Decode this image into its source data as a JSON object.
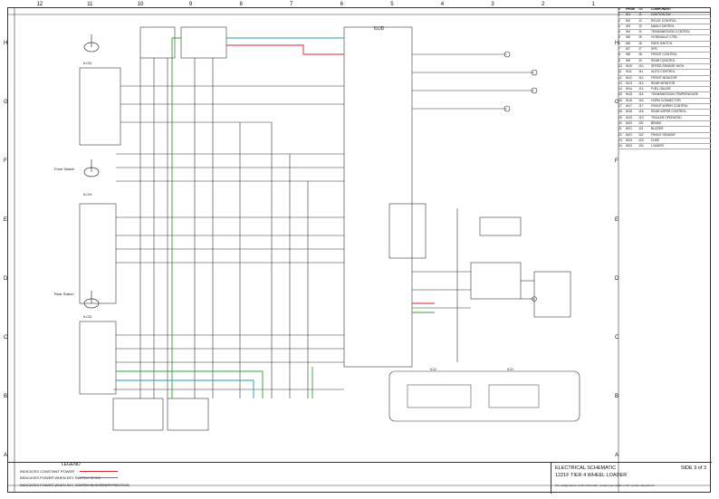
{
  "grid": {
    "columns_top": [
      "12",
      "11",
      "10",
      "9",
      "8",
      "7",
      "6",
      "5",
      "4",
      "3",
      "2",
      "1"
    ],
    "rows_left": [
      "H",
      "G",
      "F",
      "E",
      "D",
      "C",
      "B",
      "A"
    ],
    "rows_right": [
      "H",
      "G",
      "F",
      "E",
      "D",
      "C",
      "B",
      "A"
    ]
  },
  "components": {
    "top_ecu_label": "ILUD",
    "connector_left": "ILCN",
    "connector_mid": "ILCN",
    "switch_g_label": "ILCN",
    "ecu_bottom_left": "ICU",
    "ecu_bottom_right": "ICU",
    "front_switch": "Front Switch",
    "rear_switch": "Rear Switch"
  },
  "right_table": {
    "headers": [
      "#",
      "FROM",
      "TO",
      "COMPONENT"
    ],
    "rows": [
      [
        "1",
        "W1",
        "J1",
        "IGNITION SW"
      ],
      [
        "2",
        "W2",
        "J2",
        "RELAY CONTROL"
      ],
      [
        "3",
        "W3",
        "J3",
        "MAIN CONTROL"
      ],
      [
        "4",
        "W4",
        "J4",
        "TRANSMISSION CONTROL"
      ],
      [
        "5",
        "W5",
        "J5",
        "HYDRAULIC CTRL"
      ],
      [
        "6",
        "W6",
        "J6",
        "PARK SWITCH"
      ],
      [
        "7",
        "W7",
        "J7",
        "SPD"
      ],
      [
        "8",
        "W8",
        "J8",
        "FRONT CONTROL"
      ],
      [
        "9",
        "W9",
        "J9",
        "REAR CONTROL"
      ],
      [
        "10",
        "W10",
        "J10",
        "SPEED SENSOR HIGH"
      ],
      [
        "11",
        "W11",
        "J11",
        "AUTO CONTROL"
      ],
      [
        "12",
        "W12",
        "J12",
        "FRONT MONITOR"
      ],
      [
        "13",
        "W13",
        "J13",
        "REAR MONITOR"
      ],
      [
        "14",
        "W14",
        "J14",
        "FUEL GAUGE"
      ],
      [
        "15",
        "W15",
        "J15",
        "TRANSMISSION TEMPERATURE"
      ],
      [
        "16",
        "W16",
        "J16",
        "HORN CONNECTOR"
      ],
      [
        "17",
        "W17",
        "J17",
        "FRONT WIPER CONTROL"
      ],
      [
        "18",
        "W18",
        "J18",
        "REAR WIPER CONTROL"
      ],
      [
        "19",
        "W19",
        "J19",
        "TRAILER OPERATED"
      ],
      [
        "20",
        "W20",
        "J20",
        "BRAKE"
      ],
      [
        "21",
        "W21",
        "J21",
        "BUZZER"
      ],
      [
        "22",
        "W22",
        "J22",
        "FRONT SENSOR"
      ],
      [
        "23",
        "W23",
        "J23",
        "FUSE"
      ],
      [
        "24",
        "W24",
        "J24",
        "LOADER"
      ]
    ]
  },
  "legend": {
    "title": "LEGEND",
    "items": [
      {
        "text": "INDICATES CONSTANT POWER",
        "color": "#d62728"
      },
      {
        "text": "INDICATES POWER WHEN KEY SWITCH IS ON",
        "color": "#2ca02c"
      },
      {
        "text": "INDICATES POWER WHEN KEY SWITCH IS IN START POSITION",
        "color": "#17a2b8"
      }
    ]
  },
  "title_block": {
    "line1": "ELECTRICAL SCHEMATIC",
    "line2": "1221F TIER 4 WHEEL LOADER",
    "sheet": "SIDE 3 of 3",
    "note": "For configurations of this schematic, contact your dealer or the service department."
  },
  "colors": {
    "constant_power": "#d62728",
    "key_on_power": "#2ca02c",
    "start_power": "#17a2b8",
    "wire": "#333333"
  }
}
